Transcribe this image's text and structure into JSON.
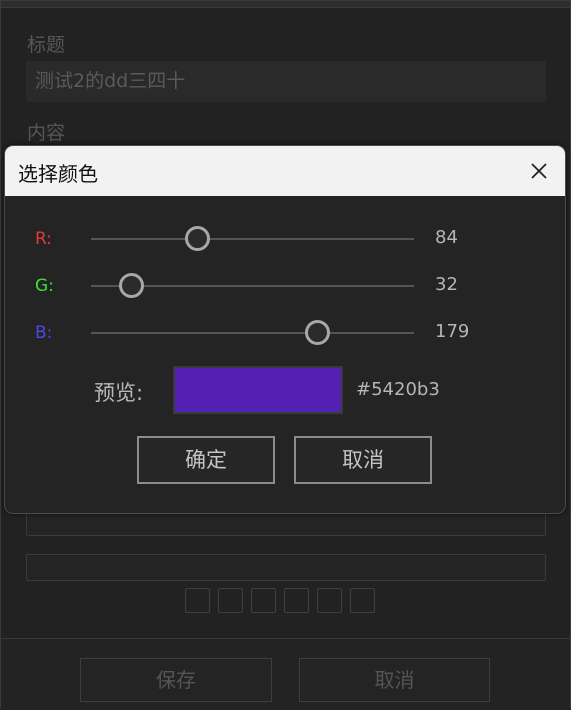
{
  "editor": {
    "title_label": "标题",
    "title_value": "测试2的dd三四十",
    "content_label": "内容",
    "save_button": "保存",
    "cancel_button": "取消"
  },
  "dialog": {
    "title": "选择颜色",
    "close_icon": "close-icon",
    "channels": [
      {
        "label": "R:",
        "value": "84",
        "fraction": 0.329,
        "color": "#e03a3a"
      },
      {
        "label": "G:",
        "value": "32",
        "fraction": 0.125,
        "color": "#3ae03a"
      },
      {
        "label": "B:",
        "value": "179",
        "fraction": 0.702,
        "color": "#4a4ae8"
      }
    ],
    "preview_label": "预览:",
    "preview_color": "#5420b3",
    "hex_value": "#5420b3",
    "ok_button": "确定",
    "cancel_button": "取消"
  }
}
